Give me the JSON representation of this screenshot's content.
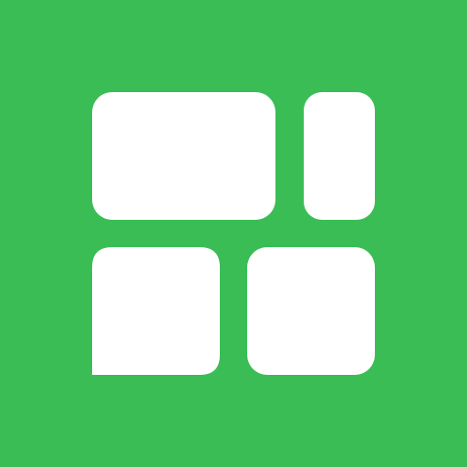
{
  "icon": {
    "name": "widget-grid-icon",
    "background_color": "#3BBD56",
    "tile_color": "#FFFFFF",
    "tiles": [
      "wide-tile",
      "tall-tile",
      "speech-bubble-tile",
      "square-tile"
    ]
  }
}
